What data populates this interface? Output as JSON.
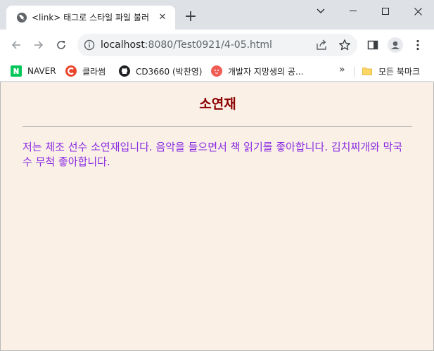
{
  "tab": {
    "title": "<link> 태그로 스타일 파일 불러",
    "close": "✕",
    "new_tab": "+"
  },
  "toolbar": {
    "url_host": "localhost",
    "url_path": ":8080/Test0921/4-05.html"
  },
  "bookmarks": {
    "items": [
      {
        "label": "NAVER",
        "icon": "naver-icon"
      },
      {
        "label": "클라썸",
        "icon": "classum-icon"
      },
      {
        "label": "CD3660 (박찬영)",
        "icon": "github-icon"
      },
      {
        "label": "개발자 지망생의 공...",
        "icon": "blog-icon"
      }
    ],
    "more": "»",
    "all_bookmarks": "모든 북마크"
  },
  "page": {
    "heading": "소연재",
    "paragraph": "저는 체조 선수 소연재입니다. 음악을 들으면서 책 읽기를 좋아합니다. 김치찌개와 막국수 무척 좋아합니다."
  },
  "colors": {
    "page_background": "#faf0e6",
    "heading": "#8b0000",
    "paragraph": "#8a2be2",
    "naver": "#03c75a",
    "classum": "#e8452c"
  }
}
